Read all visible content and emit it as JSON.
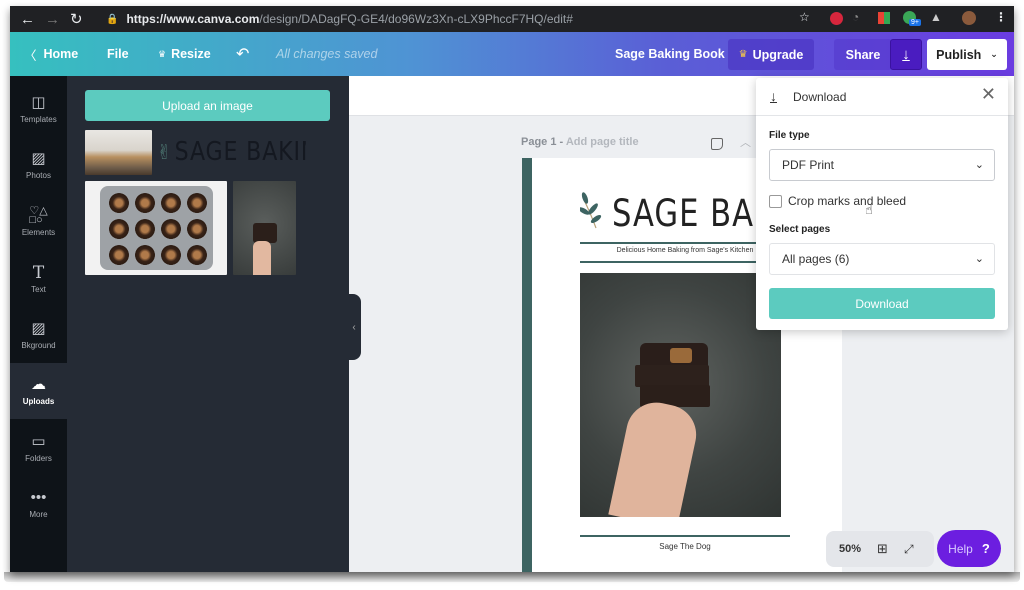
{
  "browser": {
    "url_scheme": "https://",
    "url_host": "www.canva.com",
    "url_path": "/design/DADagFQ-GE4/do96Wz3Xn-cLX9PhccF7HQ/edit#",
    "badge": "9+"
  },
  "topbar": {
    "home": "Home",
    "file": "File",
    "resize": "Resize",
    "status": "All changes saved",
    "doc_title": "Sage Baking Book",
    "upgrade": "Upgrade",
    "share": "Share",
    "publish": "Publish"
  },
  "sidebar": {
    "items": [
      {
        "label": "Templates",
        "icon": "templates-icon"
      },
      {
        "label": "Photos",
        "icon": "photos-icon"
      },
      {
        "label": "Elements",
        "icon": "elements-icon"
      },
      {
        "label": "Text",
        "icon": "text-icon"
      },
      {
        "label": "Bkground",
        "icon": "background-icon"
      },
      {
        "label": "Uploads",
        "icon": "upload-cloud-icon",
        "active": true
      },
      {
        "label": "Folders",
        "icon": "folder-icon"
      },
      {
        "label": "More",
        "icon": "more-icon"
      }
    ]
  },
  "uploads": {
    "upload_button": "Upload an image",
    "logo_text": "Sage Baking"
  },
  "editor": {
    "page_label": "Page 1 - ",
    "page_title_placeholder": "Add page title",
    "design_title": "Sage Baking",
    "subtitle": "Delicious Home Baking from Sage's Kitchen",
    "caption": "Sage The Dog"
  },
  "download": {
    "title": "Download",
    "file_type_label": "File type",
    "file_type_value": "PDF Print",
    "crop_label": "Crop marks and bleed",
    "crop_checked": false,
    "pages_label": "Select pages",
    "pages_value": "All pages (6)",
    "button": "Download"
  },
  "bottom": {
    "zoom": "50%",
    "help": "Help",
    "help_icon": "?"
  },
  "colors": {
    "accent_teal": "#5ccbbf",
    "help_purple": "#6c1ee0",
    "page_stripe": "#3d6462"
  }
}
